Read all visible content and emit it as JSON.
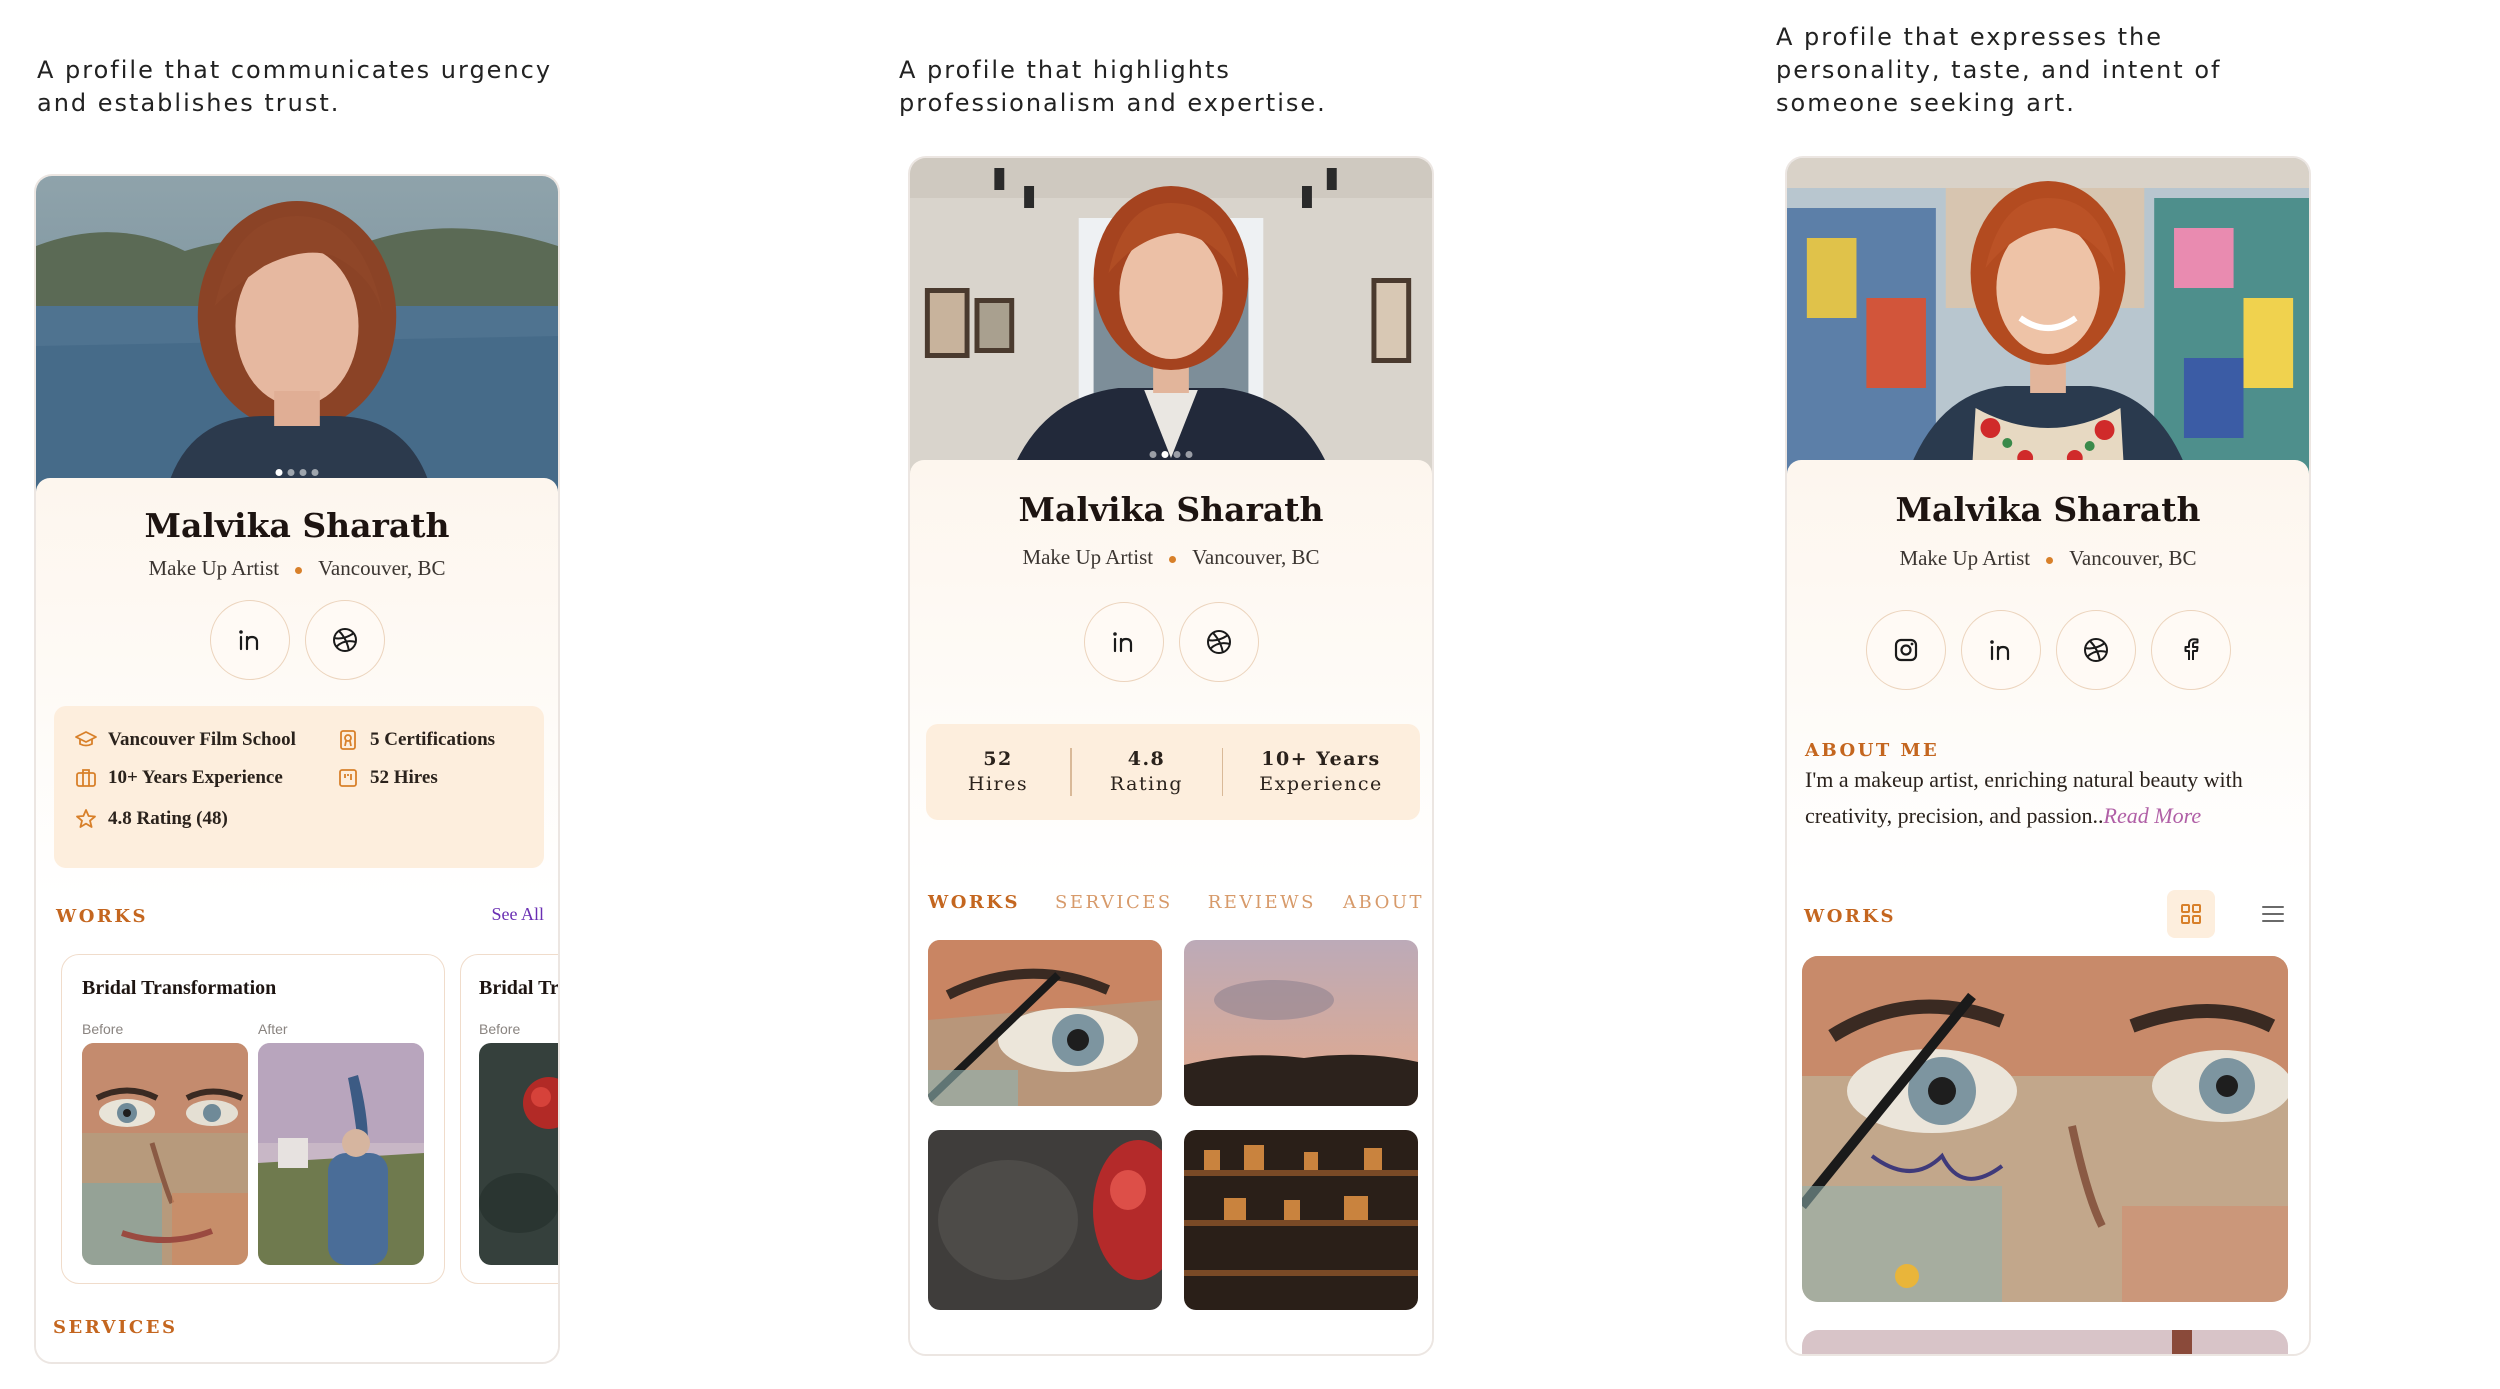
{
  "captions": [
    [
      "A profile that communicates urgency",
      "and establishes trust."
    ],
    [
      "A profile that highlights",
      "professionalism and expertise."
    ],
    [
      "A profile that expresses the",
      "personality, taste, and intent of",
      "someone seeking art."
    ]
  ],
  "profile": {
    "name": "Malvika Sharath",
    "role": "Make Up Artist",
    "location": "Vancouver, BC"
  },
  "colors": {
    "accent": "#c4661f",
    "accent_light": "#fdeedd",
    "link_purple": "#6a2fb3",
    "read_more": "#b05fa6",
    "separator_dot": "#d8802a"
  },
  "screen1": {
    "carousel_active_index": 0,
    "carousel_count": 4,
    "socials": [
      "linkedin-icon",
      "dribbble-icon"
    ],
    "info": {
      "school": "Vancouver Film School",
      "certifications": "5 Certifications",
      "experience": "10+ Years Experience",
      "hires": "52 Hires",
      "rating": "4.8 Rating (48)"
    },
    "works_label": "WORKS",
    "see_all": "See All",
    "work_cards": [
      {
        "title": "Bridal Transformation",
        "before": "Before",
        "after": "After"
      },
      {
        "title": "Bridal Tr",
        "before": "Before"
      }
    ],
    "services_label": "SERVICES"
  },
  "screen2": {
    "carousel_active_index": 1,
    "carousel_count": 4,
    "socials": [
      "linkedin-icon",
      "dribbble-icon"
    ],
    "stats": [
      {
        "value": "52",
        "label": "Hires"
      },
      {
        "value": "4.8",
        "label": "Rating"
      },
      {
        "value": "10+ Years",
        "label": "Experience"
      }
    ],
    "tabs": [
      "WORKS",
      "SERVICES",
      "REVIEWS",
      "ABOUT"
    ],
    "active_tab": "WORKS"
  },
  "screen3": {
    "socials": [
      "instagram-icon",
      "linkedin-icon",
      "dribbble-icon",
      "facebook-icon"
    ],
    "about_title": "ABOUT ME",
    "about_text_1": "I'm a makeup artist, enriching natural beauty with",
    "about_text_2": "creativity, precision, and passion..",
    "read_more": "Read More",
    "works_label": "WORKS",
    "view_mode": "grid"
  }
}
